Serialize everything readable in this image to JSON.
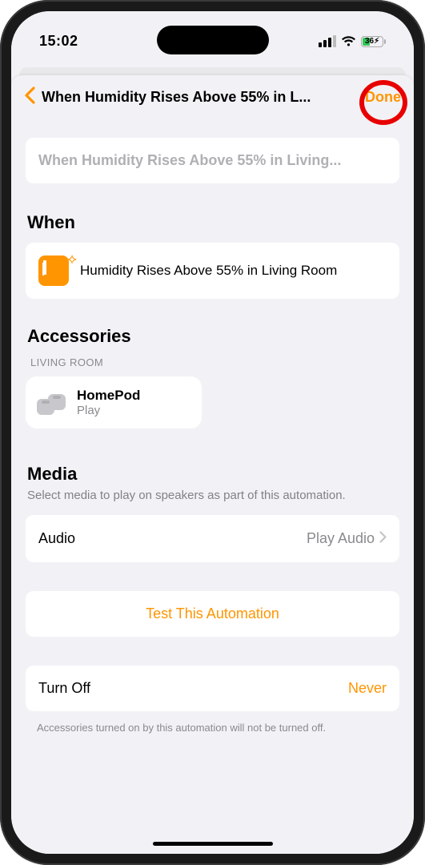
{
  "status": {
    "time": "15:02",
    "battery_pct": "36"
  },
  "nav": {
    "title": "When Humidity Rises Above 55% in L...",
    "done": "Done"
  },
  "name_field": {
    "placeholder": "When Humidity Rises Above 55% in Living..."
  },
  "when": {
    "heading": "When",
    "condition": "Humidity Rises Above 55% in Living Room"
  },
  "accessories": {
    "heading": "Accessories",
    "group": "Living Room",
    "tile": {
      "title": "HomePod",
      "sub": "Play"
    }
  },
  "media": {
    "heading": "Media",
    "subtitle": "Select media to play on speakers as part of this automation.",
    "row_label": "Audio",
    "row_value": "Play Audio"
  },
  "test": {
    "label": "Test This Automation"
  },
  "turnoff": {
    "label": "Turn Off",
    "value": "Never",
    "footer": "Accessories turned on by this automation will not be turned off."
  }
}
